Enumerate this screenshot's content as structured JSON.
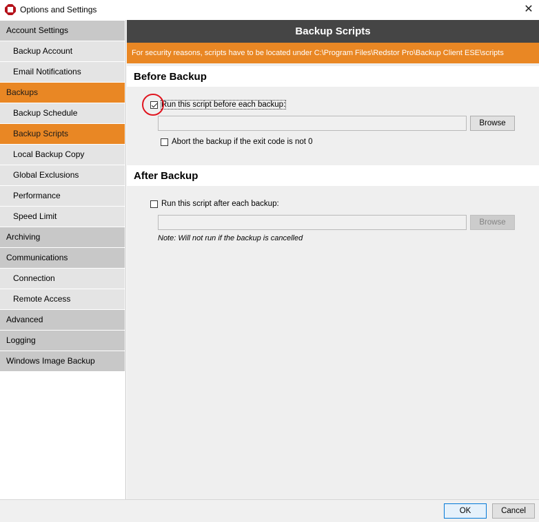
{
  "window": {
    "title": "Options and Settings",
    "app_icon": "redstor-logo-icon",
    "close_icon": "close-icon",
    "close_glyph": "✕"
  },
  "sidebar": {
    "items": [
      {
        "label": "Account Settings",
        "level": "category",
        "active": false
      },
      {
        "label": "Backup Account",
        "level": "sub",
        "active": false
      },
      {
        "label": "Email Notifications",
        "level": "sub",
        "active": false
      },
      {
        "label": "Backups",
        "level": "category",
        "active": true
      },
      {
        "label": "Backup Schedule",
        "level": "sub",
        "active": false
      },
      {
        "label": "Backup Scripts",
        "level": "sub",
        "active": true
      },
      {
        "label": "Local Backup Copy",
        "level": "sub",
        "active": false
      },
      {
        "label": "Global Exclusions",
        "level": "sub",
        "active": false
      },
      {
        "label": "Performance",
        "level": "sub",
        "active": false
      },
      {
        "label": "Speed Limit",
        "level": "sub",
        "active": false
      },
      {
        "label": "Archiving",
        "level": "category",
        "active": false
      },
      {
        "label": "Communications",
        "level": "category",
        "active": false
      },
      {
        "label": "Connection",
        "level": "sub",
        "active": false
      },
      {
        "label": "Remote Access",
        "level": "sub",
        "active": false
      },
      {
        "label": "Advanced",
        "level": "category",
        "active": false
      },
      {
        "label": "Logging",
        "level": "category",
        "active": false
      },
      {
        "label": "Windows Image Backup",
        "level": "category",
        "active": false
      }
    ]
  },
  "main": {
    "title": "Backup Scripts",
    "notice": "For security reasons, scripts have to be located under C:\\Program Files\\Redstor Pro\\Backup Client ESE\\scripts",
    "before": {
      "title": "Before Backup",
      "run_label": "Run this script before each backup:",
      "run_checked": true,
      "script_path": "",
      "browse_label": "Browse",
      "browse_enabled": true,
      "abort_label": "Abort the backup if the exit code is not 0",
      "abort_checked": false
    },
    "after": {
      "title": "After Backup",
      "run_label": "Run this script after each backup:",
      "run_checked": false,
      "script_path": "",
      "browse_label": "Browse",
      "browse_enabled": false,
      "note": "Note: Will not run if the backup is cancelled"
    }
  },
  "footer": {
    "ok_label": "OK",
    "cancel_label": "Cancel"
  },
  "colors": {
    "accent": "#e98724",
    "header": "#454545",
    "annotation": "#e0141e"
  }
}
